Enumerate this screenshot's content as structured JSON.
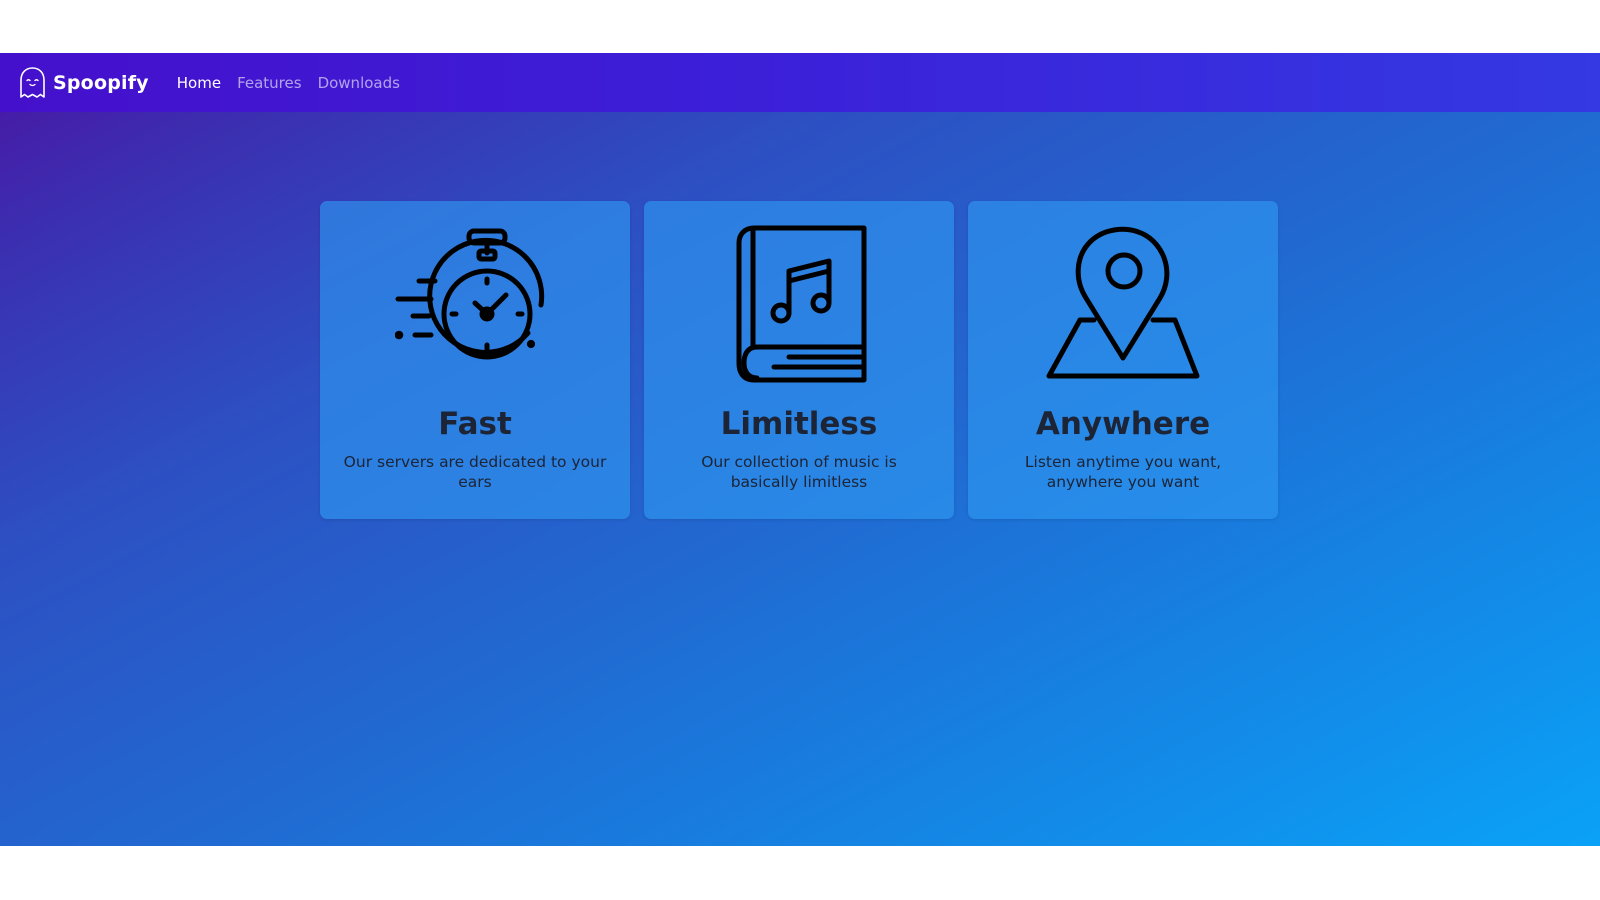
{
  "brand": {
    "name": "Spoopify",
    "logo_icon": "ghost-icon"
  },
  "nav": {
    "items": [
      {
        "label": "Home",
        "active": true
      },
      {
        "label": "Features",
        "active": false
      },
      {
        "label": "Downloads",
        "active": false
      }
    ]
  },
  "features": [
    {
      "icon": "stopwatch-icon",
      "title": "Fast",
      "text": "Our servers are dedicated to your ears"
    },
    {
      "icon": "music-book-icon",
      "title": "Limitless",
      "text": "Our collection of music is basically limitless"
    },
    {
      "icon": "map-pin-icon",
      "title": "Anywhere",
      "text": "Listen anytime you want, anywhere you want"
    }
  ],
  "colors": {
    "navbar": "#3c1fd8",
    "background_start": "#4b14a3",
    "background_end": "#0aa2f7",
    "card": "#2e99f2",
    "text_dark": "#1c2436"
  }
}
